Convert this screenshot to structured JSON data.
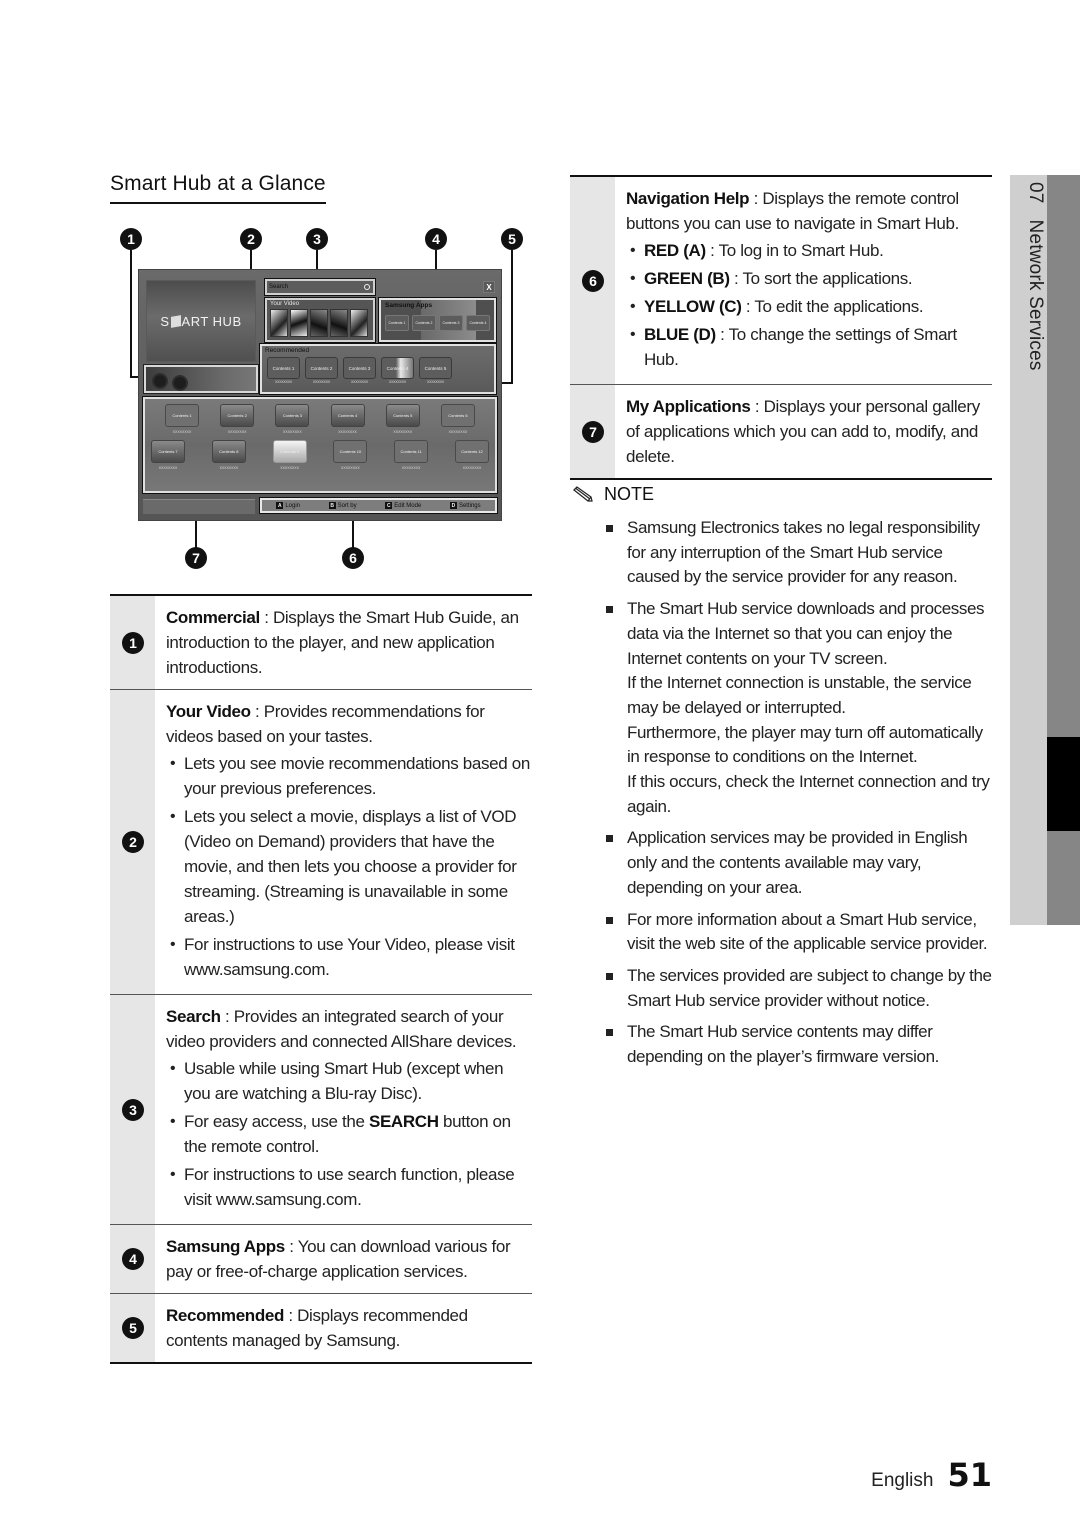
{
  "section_title": "Smart Hub at a Glance",
  "diagram": {
    "callouts": [
      "1",
      "2",
      "3",
      "4",
      "5",
      "6",
      "7"
    ],
    "logo_text_prefix": "S",
    "logo_text_suffix": "ART HUB",
    "search_label": "Search",
    "close_label": "X",
    "your_video_label": "Your Video",
    "samsung_apps_label": "Samsung Apps",
    "samsung_apps_tiles": [
      "Contents 1",
      "Contents 2",
      "Contents 3",
      "Contents 4"
    ],
    "recommended_label": "Recommended",
    "recommended_tiles": [
      {
        "label": "Contents 1",
        "caption": "XXXXXXXX"
      },
      {
        "label": "Contents 2",
        "caption": "XXXXXXXX"
      },
      {
        "label": "Contents 3",
        "caption": "XXXXXXXX"
      },
      {
        "label": "Contents 4",
        "caption": "XXXXXXXX"
      },
      {
        "label": "Contents 5",
        "caption": "XXXXXXXX"
      }
    ],
    "my_apps_row1": [
      {
        "label": "Contents 1",
        "caption": "XXXXXXXX"
      },
      {
        "label": "Contents 2",
        "caption": "XXXXXXXX"
      },
      {
        "label": "Contents 3",
        "caption": "XXXXXXXX"
      },
      {
        "label": "Contents 4",
        "caption": "XXXXXXXX"
      },
      {
        "label": "Contents 5",
        "caption": "XXXXXXXX"
      },
      {
        "label": "Contents 6",
        "caption": "XXXXXXXX"
      }
    ],
    "my_apps_row2": [
      {
        "label": "Contents 7",
        "caption": "XXXXXXXX"
      },
      {
        "label": "Contents 8",
        "caption": "XXXXXXXX"
      },
      {
        "label": "Contents 9",
        "caption": "XXXXXXXX"
      },
      {
        "label": "Contents 10",
        "caption": "XXXXXXXX"
      },
      {
        "label": "Contents 11",
        "caption": "XXXXXXXX"
      },
      {
        "label": "Contents 12",
        "caption": "XXXXXXXX"
      }
    ],
    "nav_help": [
      {
        "key": "A",
        "label": "Login"
      },
      {
        "key": "B",
        "label": "Sort by"
      },
      {
        "key": "C",
        "label": "Edit Mode"
      },
      {
        "key": "D",
        "label": "Settings"
      }
    ]
  },
  "left_table": [
    {
      "num": "1",
      "term": "Commercial",
      "desc": " : Displays the Smart Hub Guide, an introduction to the player, and new application introductions.",
      "bullets": []
    },
    {
      "num": "2",
      "term": "Your Video",
      "desc": " : Provides recommendations for videos based on your tastes.",
      "bullets": [
        "Lets you see movie recommendations based on your previous preferences.",
        "Lets you select a movie, displays a list of VOD (Video on Demand) providers that have the movie, and then lets you choose a provider for streaming. (Streaming is unavailable in some areas.)",
        "For instructions to use Your Video, please visit www.samsung.com."
      ]
    },
    {
      "num": "3",
      "term": "Search",
      "desc": " : Provides an integrated search of your video providers and connected AllShare devices.",
      "bullets": [
        "Usable while using Smart Hub (except when you are watching a Blu-ray Disc).",
        "For easy access, use the |SEARCH| button on the remote control.",
        "For instructions to use search function, please visit www.samsung.com."
      ]
    },
    {
      "num": "4",
      "term": "Samsung Apps",
      "desc": " : You can download various for pay or free-of-charge application services.",
      "bullets": []
    },
    {
      "num": "5",
      "term": "Recommended",
      "desc": " : Displays recommended contents managed by Samsung.",
      "bullets": []
    }
  ],
  "right_table": [
    {
      "num": "6",
      "term": "Navigation Help",
      "desc": " : Displays the remote control buttons you can use to navigate in Smart Hub.",
      "bullets": [
        {
          "term": "RED (A)",
          "text": " : To log in to Smart Hub."
        },
        {
          "term": "GREEN (B)",
          "text": " : To sort the applications."
        },
        {
          "term": "YELLOW (C)",
          "text": " : To edit the applications."
        },
        {
          "term": "BLUE (D)",
          "text": " : To change the settings of Smart Hub."
        }
      ]
    },
    {
      "num": "7",
      "term": "My Applications",
      "desc": " : Displays your personal gallery of applications which you can add to, modify, and delete.",
      "bullets": []
    }
  ],
  "note": {
    "title": "NOTE",
    "items": [
      [
        "Samsung Electronics takes no legal responsibility for any interruption of the Smart Hub service caused by the service provider for any reason."
      ],
      [
        "The Smart Hub service downloads and processes data via the Internet so that you can enjoy the Internet contents on your TV screen.",
        "If the Internet connection is unstable, the service may be delayed or interrupted.",
        "Furthermore, the player may turn off automatically in response to conditions on the Internet.",
        "If this occurs, check the Internet connection and try again."
      ],
      [
        "Application services may be provided in English only and the contents available may vary, depending on your area."
      ],
      [
        "For more information about a Smart Hub service, visit the web site of the applicable service provider."
      ],
      [
        "The services provided are subject to change by the Smart Hub service provider without notice."
      ],
      [
        "The Smart Hub service contents may differ depending on the player’s firmware version."
      ]
    ]
  },
  "side_tab": {
    "chapter": "07",
    "title": "Network Services"
  },
  "footer": {
    "language": "English",
    "page": "51"
  }
}
